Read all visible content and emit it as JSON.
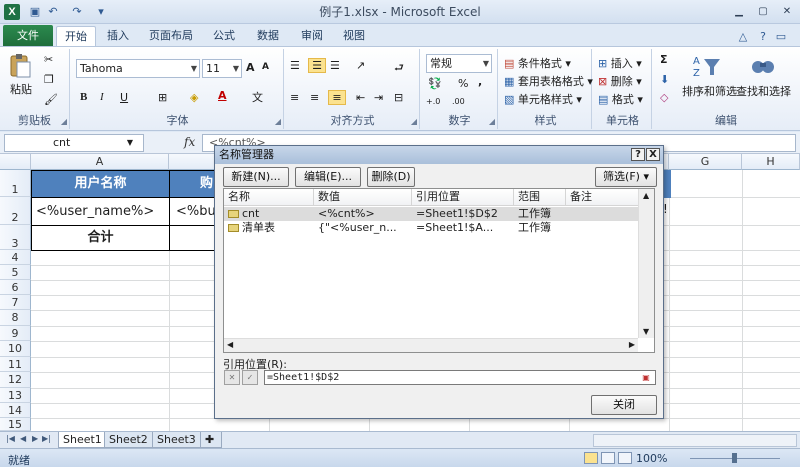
{
  "window": {
    "title": "例子1.xlsx - Microsoft Excel",
    "app_icon": "excel-icon",
    "qat": [
      "save-icon",
      "undo-icon",
      "redo-icon",
      "customize-icon"
    ],
    "controls": [
      "minimize-icon",
      "maximize-icon",
      "close-icon"
    ]
  },
  "ribbon_tabs": {
    "file": "文件",
    "items": [
      "开始",
      "插入",
      "页面布局",
      "公式",
      "数据",
      "审阅",
      "视图"
    ],
    "active": "开始"
  },
  "ribbon": {
    "clipboard": {
      "label": "剪贴板",
      "paste": "粘贴"
    },
    "font": {
      "label": "字体",
      "name": "Tahoma",
      "size": "11",
      "bold": "B",
      "italic": "I",
      "underline": "U",
      "grow": "A",
      "shrink": "A",
      "phonetic": "文"
    },
    "alignment": {
      "label": "对齐方式"
    },
    "number": {
      "label": "数字",
      "format": "常规",
      "percent": "%",
      "comma": ",",
      "increase_decimal": "+.0",
      "decrease_decimal": ".00"
    },
    "styles": {
      "label": "样式",
      "conditional": "条件格式",
      "table": "套用表格格式",
      "cell_styles": "单元格样式"
    },
    "cells": {
      "label": "单元格",
      "insert": "插入",
      "delete": "删除",
      "format": "格式"
    },
    "editing": {
      "label": "编辑",
      "sigma": "Σ",
      "sort_filter": "排序和筛选",
      "find_select": "查找和选择"
    }
  },
  "formula_bar": {
    "name_box": "cnt",
    "fx": "fx",
    "content": "<%cnt%>"
  },
  "grid": {
    "columns": [
      "A",
      "B",
      "C",
      "D",
      "E",
      "F",
      "G",
      "H"
    ],
    "rows": [
      "1",
      "2",
      "3",
      "4",
      "5",
      "6",
      "7",
      "8",
      "9",
      "10",
      "11",
      "12",
      "13",
      "14",
      "15"
    ],
    "a1": "用户名称",
    "b1": "购",
    "a2": "<%user_name%>",
    "b2": "<%buy",
    "a3": "合计",
    "f2_fragment": "!"
  },
  "sheets": {
    "tabs": [
      "Sheet1",
      "Sheet2",
      "Sheet3"
    ],
    "active": "Sheet1"
  },
  "status": {
    "ready": "就绪",
    "zoom": "100%"
  },
  "name_manager": {
    "title": "名称管理器",
    "help": "?",
    "close_x": "X",
    "new_btn": "新建(N)...",
    "edit_btn": "编辑(E)...",
    "delete_btn": "删除(D)",
    "filter_btn": "筛选(F) ▾",
    "headers": [
      "名称",
      "数值",
      "引用位置",
      "范围",
      "备注"
    ],
    "rows": [
      {
        "name": "cnt",
        "value": "<%cnt%>",
        "ref": "=Sheet1!$D$2",
        "scope": "工作簿",
        "note": ""
      },
      {
        "name": "清单表",
        "value": "{\"<%user_n...",
        "ref": "=Sheet1!$A...",
        "scope": "工作簿",
        "note": ""
      }
    ],
    "ref_label": "引用位置(R):",
    "ref_value": "=Sheet1!$D$2",
    "close_btn": "关闭"
  }
}
